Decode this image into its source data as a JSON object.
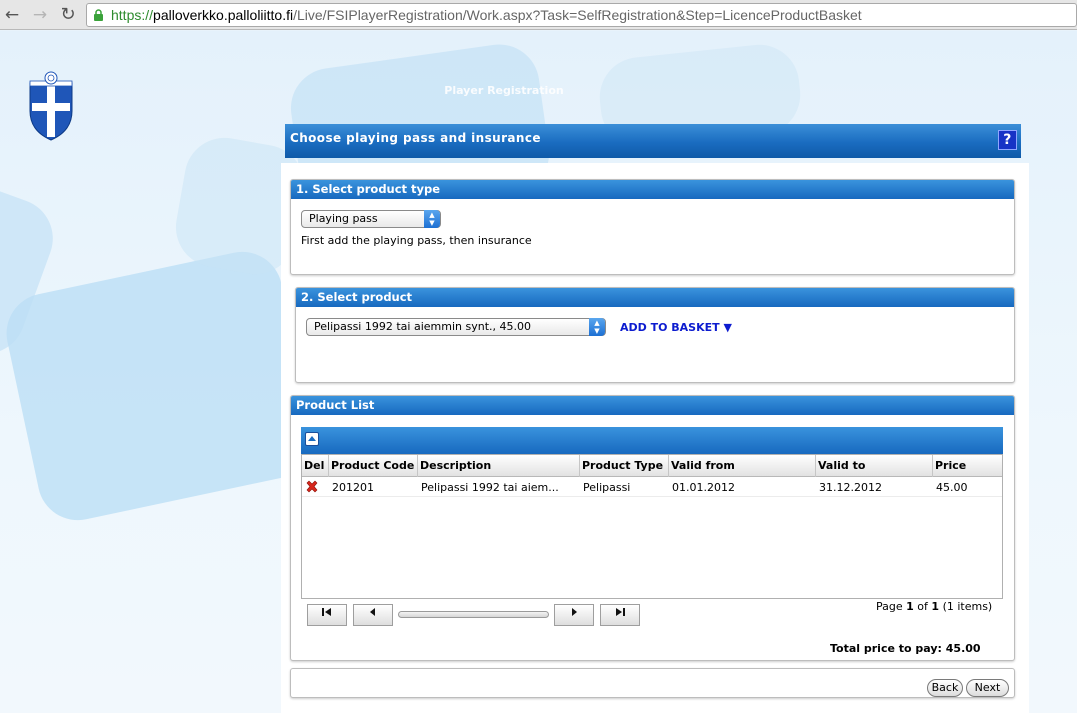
{
  "browser": {
    "url_scheme": "https://",
    "url_host": "palloverkko.palloliitto.fi",
    "url_path": "/Live/FSIPlayerRegistration/Work.aspx?Task=SelfRegistration&Step=LicenceProductBasket"
  },
  "site": {
    "title": "Player Registration",
    "logo_icon": "football-association-crest-icon"
  },
  "main": {
    "title": "Choose playing pass and insurance",
    "help_label": "?"
  },
  "section1": {
    "title": "1. Select product type",
    "select_value": "Playing pass",
    "hint": "First add the playing pass, then insurance"
  },
  "section2": {
    "title": "2. Select product",
    "select_value": "Pelipassi 1992 tai aiemmin synt., 45.00",
    "add_label": "ADD TO BASKET ▼"
  },
  "product_list": {
    "title": "Product List",
    "columns": [
      "Del",
      "Product Code",
      "Description",
      "Product Type",
      "Valid from",
      "Valid to",
      "Price"
    ],
    "rows": [
      {
        "code": "201201",
        "description": "Pelipassi 1992 tai aiem...",
        "type": "Pelipassi",
        "valid_from": "01.01.2012",
        "valid_to": "31.12.2012",
        "price": "45.00"
      }
    ],
    "pager": {
      "page_prefix": "Page",
      "page_current": "1",
      "page_of": "of",
      "page_total": "1",
      "items": "(1 items)"
    },
    "total_label": "Total price to pay: 45.00"
  },
  "buttons": {
    "back": "Back",
    "next": "Next"
  },
  "colors": {
    "header_blue": "#1a6cc0",
    "link_blue": "#0d1ccf",
    "help_blue": "#1733c6"
  }
}
